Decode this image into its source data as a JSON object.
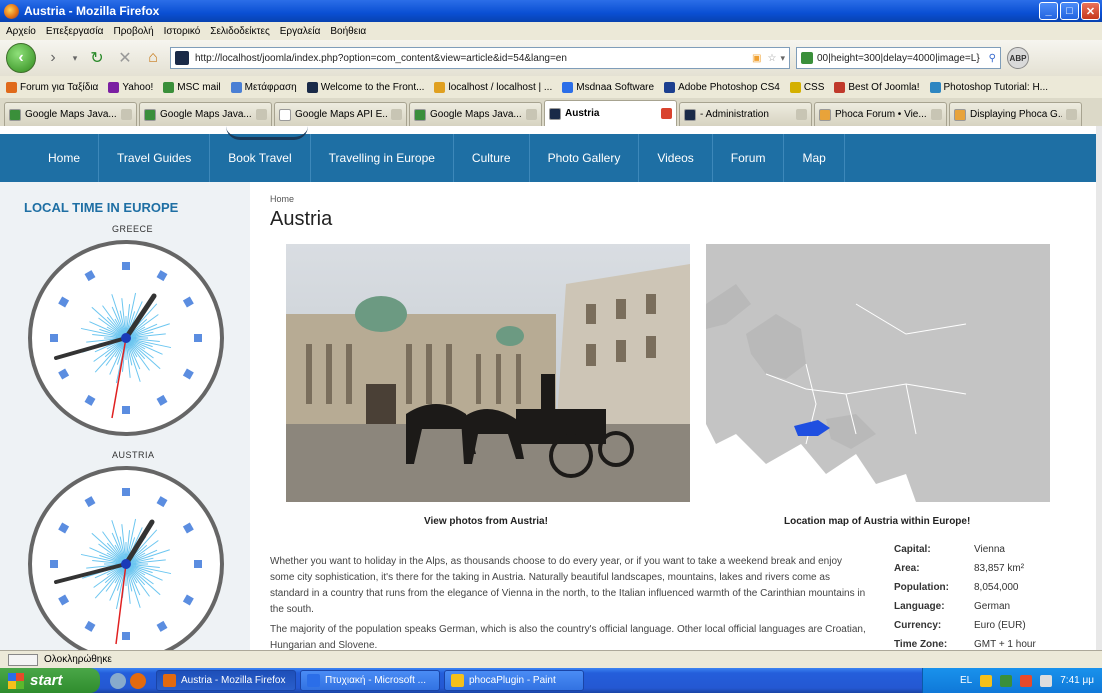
{
  "window": {
    "title": "Austria - Mozilla Firefox"
  },
  "menu": [
    "Αρχείο",
    "Επεξεργασία",
    "Προβολή",
    "Ιστορικό",
    "Σελιδοδείκτες",
    "Εργαλεία",
    "Βοήθεια"
  ],
  "navbar": {
    "url": "http://localhost/joomla/index.php?option=com_content&view=article&id=54&lang=en",
    "search": "00|height=300|delay=4000|image=L}",
    "abp": "ABP"
  },
  "bookmarks": [
    {
      "label": "Forum για Ταξίδια",
      "color": "#e06a1b"
    },
    {
      "label": "Yahoo!",
      "color": "#7b1fa2"
    },
    {
      "label": "MSC mail",
      "color": "#3a8f3a"
    },
    {
      "label": "Μετάφραση",
      "color": "#4a7fd4"
    },
    {
      "label": "Welcome to the Front...",
      "color": "#1a2a48"
    },
    {
      "label": "localhost / localhost | ...",
      "color": "#e0a020"
    },
    {
      "label": "Msdnaa Software",
      "color": "#2b6ee8"
    },
    {
      "label": "Adobe Photoshop CS4",
      "color": "#1c3f8f"
    },
    {
      "label": "CSS",
      "color": "#d4b000"
    },
    {
      "label": "Best Of Joomla!",
      "color": "#c0392b"
    },
    {
      "label": "Photoshop Tutorial: H...",
      "color": "#2e86c1"
    }
  ],
  "tabs": [
    {
      "label": "Google Maps Java...",
      "color": "#3a8f3a"
    },
    {
      "label": "Google Maps Java...",
      "color": "#3a8f3a"
    },
    {
      "label": "Google Maps API E...",
      "color": "#ffffff"
    },
    {
      "label": "Google Maps Java...",
      "color": "#3a8f3a"
    },
    {
      "label": "Austria",
      "color": "#1a2a48",
      "active": true
    },
    {
      "label": "- Administration",
      "color": "#1a2a48"
    },
    {
      "label": "Phoca Forum • Vie...",
      "color": "#e8a33a"
    },
    {
      "label": "Displaying Phoca G...",
      "color": "#e8a33a"
    }
  ],
  "site": {
    "nav": [
      "Home",
      "Travel Guides",
      "Book Travel",
      "Travelling in Europe",
      "Culture",
      "Photo Gallery",
      "Videos",
      "Forum",
      "Map"
    ],
    "sidebar_title": "LOCAL TIME IN EUROPE",
    "clocks": [
      {
        "label": "GREECE"
      },
      {
        "label": "AUSTRIA"
      }
    ],
    "breadcrumb": "Home",
    "title": "Austria",
    "caption_photos": "View photos from Austria!",
    "caption_map": "Location map of Austria within Europe!",
    "para1": "Whether you want to holiday in the Alps, as thousands choose to do every year, or if you want to take a weekend break and enjoy some city sophistication, it's there for the taking in Austria. Naturally beautiful landscapes, mountains, lakes and rivers come as standard in a country that runs from the elegance of Vienna in the north, to the Italian influenced warmth of the Carinthian mountains in the south.",
    "para2": "The majority of the population speaks German, which is also the country's official language. Other local official languages are Croatian, Hungarian and Slovene.",
    "facts": [
      {
        "k": "Capital:",
        "v": "Vienna"
      },
      {
        "k": "Area:",
        "v": "83,857 km²"
      },
      {
        "k": "Population:",
        "v": "8,054,000"
      },
      {
        "k": "Language:",
        "v": "German"
      },
      {
        "k": "Currency:",
        "v": "Euro (EUR)"
      },
      {
        "k": "Time Zone:",
        "v": "GMT + 1 hour"
      }
    ]
  },
  "status": {
    "text": "Ολοκληρώθηκε"
  },
  "taskbar": {
    "start": "start",
    "buttons": [
      {
        "label": "Austria - Mozilla Firefox",
        "color": "#e36a0f",
        "active": true
      },
      {
        "label": "Πτυχιακή - Microsoft ...",
        "color": "#2b6ee8"
      },
      {
        "label": "phocaPlugin - Paint",
        "color": "#f4c01b"
      }
    ],
    "lang": "EL",
    "time": "7:41 μμ"
  }
}
